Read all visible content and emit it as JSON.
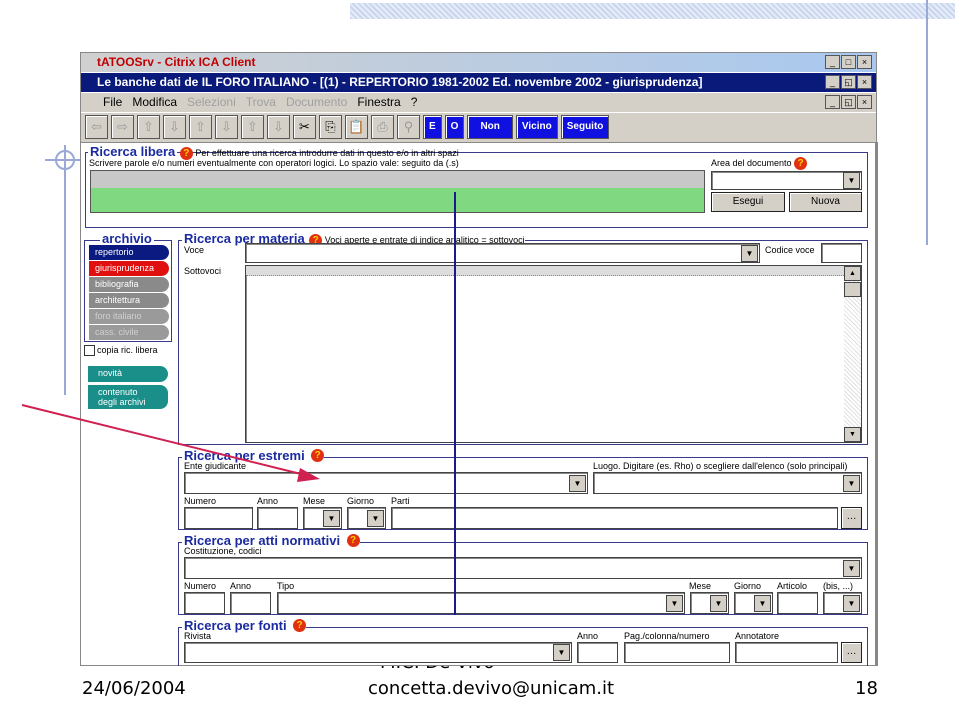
{
  "window": {
    "citrix_title": "tATOOSrv - Citrix ICA Client",
    "app_title": "Le banche dati de IL FORO ITALIANO - [(1) - REPERTORIO 1981-2002 Ed. novembre 2002 - giurisprudenza]"
  },
  "menu": [
    "File",
    "Modifica",
    "Selezioni",
    "Trova",
    "Documento",
    "Finestra",
    "?"
  ],
  "toolbar": {
    "operators": [
      "E",
      "O",
      "Non",
      "Vicino",
      "Seguito"
    ]
  },
  "ricerca_libera": {
    "title": "Ricerca libera",
    "hint": "Per effettuare una ricerca introdurre dati in questo e/o in altri spazi",
    "instructions": "Scrivere parole e/o numeri eventualmente con operatori logici. Lo spazio vale: seguito da (.s)",
    "area_label": "Area del documento",
    "esegui": "Esegui",
    "nuova": "Nuova"
  },
  "archivio": {
    "title": "archivio",
    "items": [
      "repertorio",
      "giurisprudenza",
      "bibliografia",
      "architettura",
      "foro italiano",
      "cass. civile"
    ],
    "copia": "copia ric. libera",
    "novita": "novità",
    "contenuto": "contenuto degli archivi"
  },
  "materia": {
    "title": "Ricerca per materia",
    "hint": "Voci aperte e entrate di indice analitico = sottovoci",
    "voce": "Voce",
    "codice": "Codice voce",
    "sottovoci": "Sottovoci"
  },
  "estremi": {
    "title": "Ricerca per estremi",
    "ente": "Ente giudicante",
    "luogo": "Luogo. Digitare (es. Rho) o scegliere dall'elenco (solo principali)",
    "numero": "Numero",
    "anno": "Anno",
    "mese": "Mese",
    "giorno": "Giorno",
    "parti": "Parti"
  },
  "atti": {
    "title": "Ricerca per atti normativi",
    "costituzione": "Costituzione, codici",
    "numero": "Numero",
    "anno": "Anno",
    "tipo": "Tipo",
    "mese": "Mese",
    "giorno": "Giorno",
    "articolo": "Articolo",
    "bis": "(bis, ...)"
  },
  "fonti": {
    "title": "Ricerca per fonti",
    "rivista": "Rivista",
    "anno": "Anno",
    "pag": "Pag./colonna/numero",
    "annotatore": "Annotatore"
  },
  "footer": {
    "date": "24/06/2004",
    "author": "M.C. De Vivo",
    "email": "concetta.devivo@unicam.it",
    "page": "18"
  },
  "colors": {
    "title_bar": "#0a1a7a",
    "group_title": "#1a2aa0",
    "green_field": "#80d880",
    "selected_archive": "#e01010",
    "arrow": "#d02050"
  }
}
